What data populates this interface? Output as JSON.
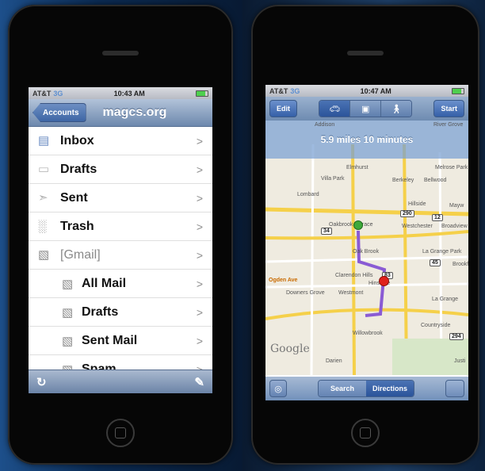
{
  "mail": {
    "status": {
      "carrier": "AT&T",
      "network": "3G",
      "time": "10:43 AM"
    },
    "nav": {
      "back_label": "Accounts",
      "title": "magcs.org"
    },
    "items": [
      {
        "label": "Inbox",
        "icon": "inbox-icon",
        "sub": false,
        "muted": false
      },
      {
        "label": "Drafts",
        "icon": "drafts-icon",
        "sub": false,
        "muted": false
      },
      {
        "label": "Sent",
        "icon": "sent-icon",
        "sub": false,
        "muted": false
      },
      {
        "label": "Trash",
        "icon": "trash-icon",
        "sub": false,
        "muted": false
      },
      {
        "label": "[Gmail]",
        "icon": "folder-icon",
        "sub": false,
        "muted": true
      },
      {
        "label": "All Mail",
        "icon": "folder-icon",
        "sub": true,
        "muted": false
      },
      {
        "label": "Drafts",
        "icon": "folder-icon",
        "sub": true,
        "muted": false
      },
      {
        "label": "Sent Mail",
        "icon": "folder-icon",
        "sub": true,
        "muted": false
      },
      {
        "label": "Spam",
        "icon": "folder-icon",
        "sub": true,
        "muted": false
      }
    ],
    "chevron": ">",
    "toolbar": {
      "refresh_icon": "refresh-icon",
      "compose_icon": "compose-icon"
    }
  },
  "maps": {
    "status": {
      "carrier": "AT&T",
      "network": "3G",
      "time": "10:47 AM"
    },
    "top": {
      "edit_label": "Edit",
      "start_label": "Start",
      "modes": [
        "car-icon",
        "bus-icon",
        "walk-icon"
      ],
      "active_mode": 0
    },
    "route": {
      "summary": "5.9 miles 10 minutes"
    },
    "labels": [
      "Addison",
      "River Grove",
      "Elmhurst",
      "Melrose Park",
      "Villa Park",
      "Berkeley",
      "Bellwood",
      "Lombard",
      "Hillside",
      "Mayw",
      "Oakbrook Terrace",
      "Westchester",
      "Broadview",
      "Oak Brook",
      "La Grange Park",
      "Brookfie",
      "Clarendon Hills",
      "Hinsdale",
      "La Grange",
      "Ogden Ave",
      "Downers Grove",
      "Westmont",
      "Countryside",
      "Willowbrook",
      "Google",
      "Justi",
      "Darien"
    ],
    "shields": [
      "83",
      "290",
      "12",
      "294",
      "34",
      "45"
    ],
    "bottom": {
      "search_label": "Search",
      "directions_label": "Directions",
      "active": "directions"
    }
  }
}
